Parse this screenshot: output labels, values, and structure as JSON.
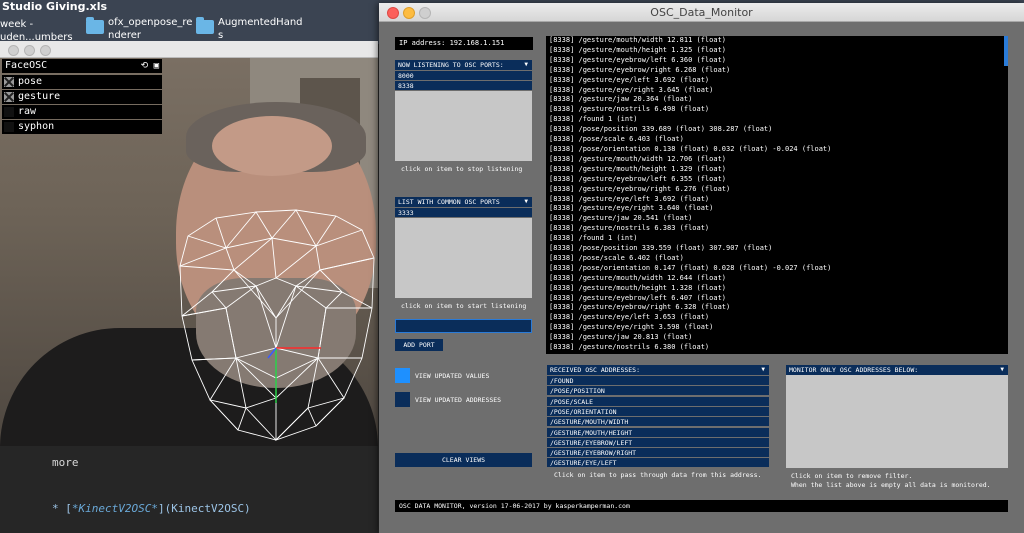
{
  "desktop": {
    "icons": [
      {
        "label": "Studio Giving.xls"
      },
      {
        "label": "week -\nuden...umbers"
      },
      {
        "label": "ofx_openpose_re\nnderer"
      },
      {
        "label": "AugmentedHand\ns"
      }
    ]
  },
  "face_window": {
    "gui_title": "FaceOSC",
    "gui_icons": "⟲ ▣",
    "items": [
      {
        "label": "pose",
        "checked": true
      },
      {
        "label": "gesture",
        "checked": true
      },
      {
        "label": "raw",
        "checked": false
      },
      {
        "label": "syphon",
        "checked": false
      }
    ]
  },
  "editor": {
    "more": "more",
    "link_prefix": "* [",
    "link_em": "*KinectV2OSC*",
    "link_suffix": "](KinectV2OSC)"
  },
  "osc": {
    "title": "OSC_Data_Monitor",
    "ip": "IP address: 192.168.1.151",
    "listening": {
      "header": "NOW LISTENING TO OSC PORTS:",
      "ports": [
        "8000",
        "8338"
      ],
      "hint": "click on item to stop listening"
    },
    "common": {
      "header": "LIST WITH COMMON OSC PORTS",
      "ports": [
        "3333"
      ],
      "hint": "click on item to start listening"
    },
    "add_port": "ADD PORT",
    "view_values": "VIEW UPDATED VALUES",
    "view_addresses": "VIEW UPDATED ADDRESSES",
    "clear_views": "CLEAR VIEWS",
    "received": {
      "header": "RECEIVED OSC ADDRESSES:",
      "items": [
        "/FOUND",
        "/POSE/POSITION",
        "/POSE/SCALE",
        "/POSE/ORIENTATION",
        "/GESTURE/MOUTH/WIDTH",
        "/GESTURE/MOUTH/HEIGHT",
        "/GESTURE/EYEBROW/LEFT",
        "/GESTURE/EYEBROW/RIGHT",
        "/GESTURE/EYE/LEFT"
      ],
      "hint": "Click on item to pass through data from this address."
    },
    "monitor_only": {
      "header": "MONITOR ONLY OSC ADDRESSES BELOW:",
      "hint1": "Click on item to remove filter.",
      "hint2": "When the list above is empty all data is monitored."
    },
    "log": [
      "[8338] /gesture/mouth/width 12.811 (float)",
      "[8338] /gesture/mouth/height 1.325 (float)",
      "[8338] /gesture/eyebrow/left 6.360 (float)",
      "[8338] /gesture/eyebrow/right 6.268 (float)",
      "[8338] /gesture/eye/left 3.692 (float)",
      "[8338] /gesture/eye/right 3.645 (float)",
      "[8338] /gesture/jaw 20.364 (float)",
      "[8338] /gesture/nostrils 6.498 (float)",
      "[8338] /found 1 (int)",
      "[8338] /pose/position 339.689 (float) 308.287 (float)",
      "[8338] /pose/scale 6.403 (float)",
      "[8338] /pose/orientation 0.138 (float) 0.032 (float) -0.024 (float)",
      "[8338] /gesture/mouth/width 12.706 (float)",
      "[8338] /gesture/mouth/height 1.329 (float)",
      "[8338] /gesture/eyebrow/left 6.355 (float)",
      "[8338] /gesture/eyebrow/right 6.276 (float)",
      "[8338] /gesture/eye/left 3.692 (float)",
      "[8338] /gesture/eye/right 3.640 (float)",
      "[8338] /gesture/jaw 20.541 (float)",
      "[8338] /gesture/nostrils 6.383 (float)",
      "[8338] /found 1 (int)",
      "[8338] /pose/position 339.559 (float) 307.907 (float)",
      "[8338] /pose/scale 6.402 (float)",
      "[8338] /pose/orientation 0.147 (float) 0.028 (float) -0.027 (float)",
      "[8338] /gesture/mouth/width 12.644 (float)",
      "[8338] /gesture/mouth/height 1.328 (float)",
      "[8338] /gesture/eyebrow/left 6.407 (float)",
      "[8338] /gesture/eyebrow/right 6.328 (float)",
      "[8338] /gesture/eye/left 3.653 (float)",
      "[8338] /gesture/eye/right 3.598 (float)",
      "[8338] /gesture/jaw 20.813 (float)",
      "[8338] /gesture/nostrils 6.380 (float)"
    ],
    "footer": "OSC DATA MONITOR, version 17-06-2017 by kasperkamperman.com"
  },
  "colors": {
    "accent": "#0a2d5a",
    "toggle_on": "#1e90ff",
    "mesh": "#ffffff"
  }
}
